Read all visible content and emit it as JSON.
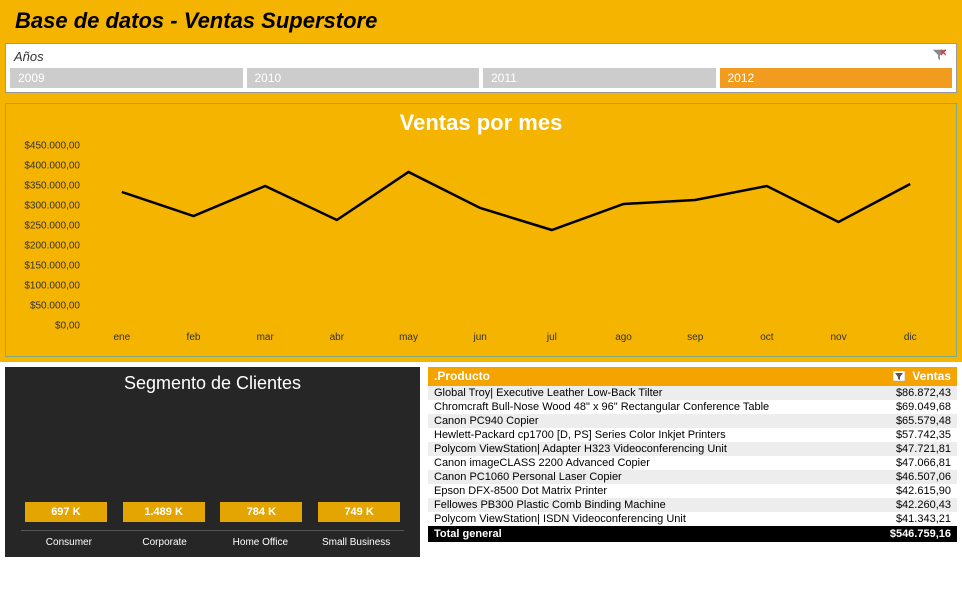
{
  "header": {
    "title": "Base de datos - Ventas Superstore"
  },
  "slicer": {
    "label": "Años",
    "items": [
      {
        "label": "2009",
        "selected": false
      },
      {
        "label": "2010",
        "selected": false
      },
      {
        "label": "2011",
        "selected": false
      },
      {
        "label": "2012",
        "selected": true
      }
    ]
  },
  "colors": {
    "accent": "#f4b400",
    "selected": "#f29c1f",
    "dark_panel": "#262626"
  },
  "chart_data": [
    {
      "type": "line",
      "title": "Ventas por mes",
      "xlabel": "",
      "ylabel": "",
      "ylim": [
        0,
        450000
      ],
      "y_ticks": [
        "$0,00",
        "$50.000,00",
        "$100.000,00",
        "$150.000,00",
        "$200.000,00",
        "$250.000,00",
        "$300.000,00",
        "$350.000,00",
        "$400.000,00",
        "$450.000,00"
      ],
      "categories": [
        "ene",
        "feb",
        "mar",
        "abr",
        "may",
        "jun",
        "jul",
        "ago",
        "sep",
        "oct",
        "nov",
        "dic"
      ],
      "values": [
        335000,
        275000,
        350000,
        265000,
        385000,
        295000,
        240000,
        305000,
        315000,
        350000,
        260000,
        355000
      ]
    },
    {
      "type": "bar",
      "title": "Segmento de Clientes",
      "categories": [
        "Consumer",
        "Corporate",
        "Home Office",
        "Small Business"
      ],
      "values": [
        697,
        1489,
        784,
        749
      ],
      "value_labels": [
        "697 K",
        "1.489 K",
        "784 K",
        "749 K"
      ],
      "ylim": [
        0,
        1500
      ]
    }
  ],
  "product_table": {
    "headers": {
      "product": ".Producto",
      "sales": "Ventas"
    },
    "rows": [
      {
        "product": "Global Troy| Executive Leather Low-Back Tilter",
        "sales": "$86.872,43"
      },
      {
        "product": "Chromcraft Bull-Nose Wood 48\" x 96\" Rectangular Conference Table",
        "sales": "$69.049,68"
      },
      {
        "product": "Canon PC940 Copier",
        "sales": "$65.579,48"
      },
      {
        "product": "Hewlett-Packard cp1700 [D, PS] Series Color Inkjet Printers",
        "sales": "$57.742,35"
      },
      {
        "product": "Polycom ViewStation| Adapter H323 Videoconferencing Unit",
        "sales": "$47.721,81"
      },
      {
        "product": "Canon imageCLASS 2200 Advanced Copier",
        "sales": "$47.066,81"
      },
      {
        "product": "Canon PC1060 Personal Laser Copier",
        "sales": "$46.507,06"
      },
      {
        "product": "Epson DFX-8500 Dot Matrix Printer",
        "sales": "$42.615,90"
      },
      {
        "product": "Fellowes PB300 Plastic Comb Binding Machine",
        "sales": "$42.260,43"
      },
      {
        "product": "Polycom ViewStation| ISDN Videoconferencing Unit",
        "sales": "$41.343,21"
      }
    ],
    "footer": {
      "label": "Total general",
      "value": "$546.759,16"
    }
  }
}
